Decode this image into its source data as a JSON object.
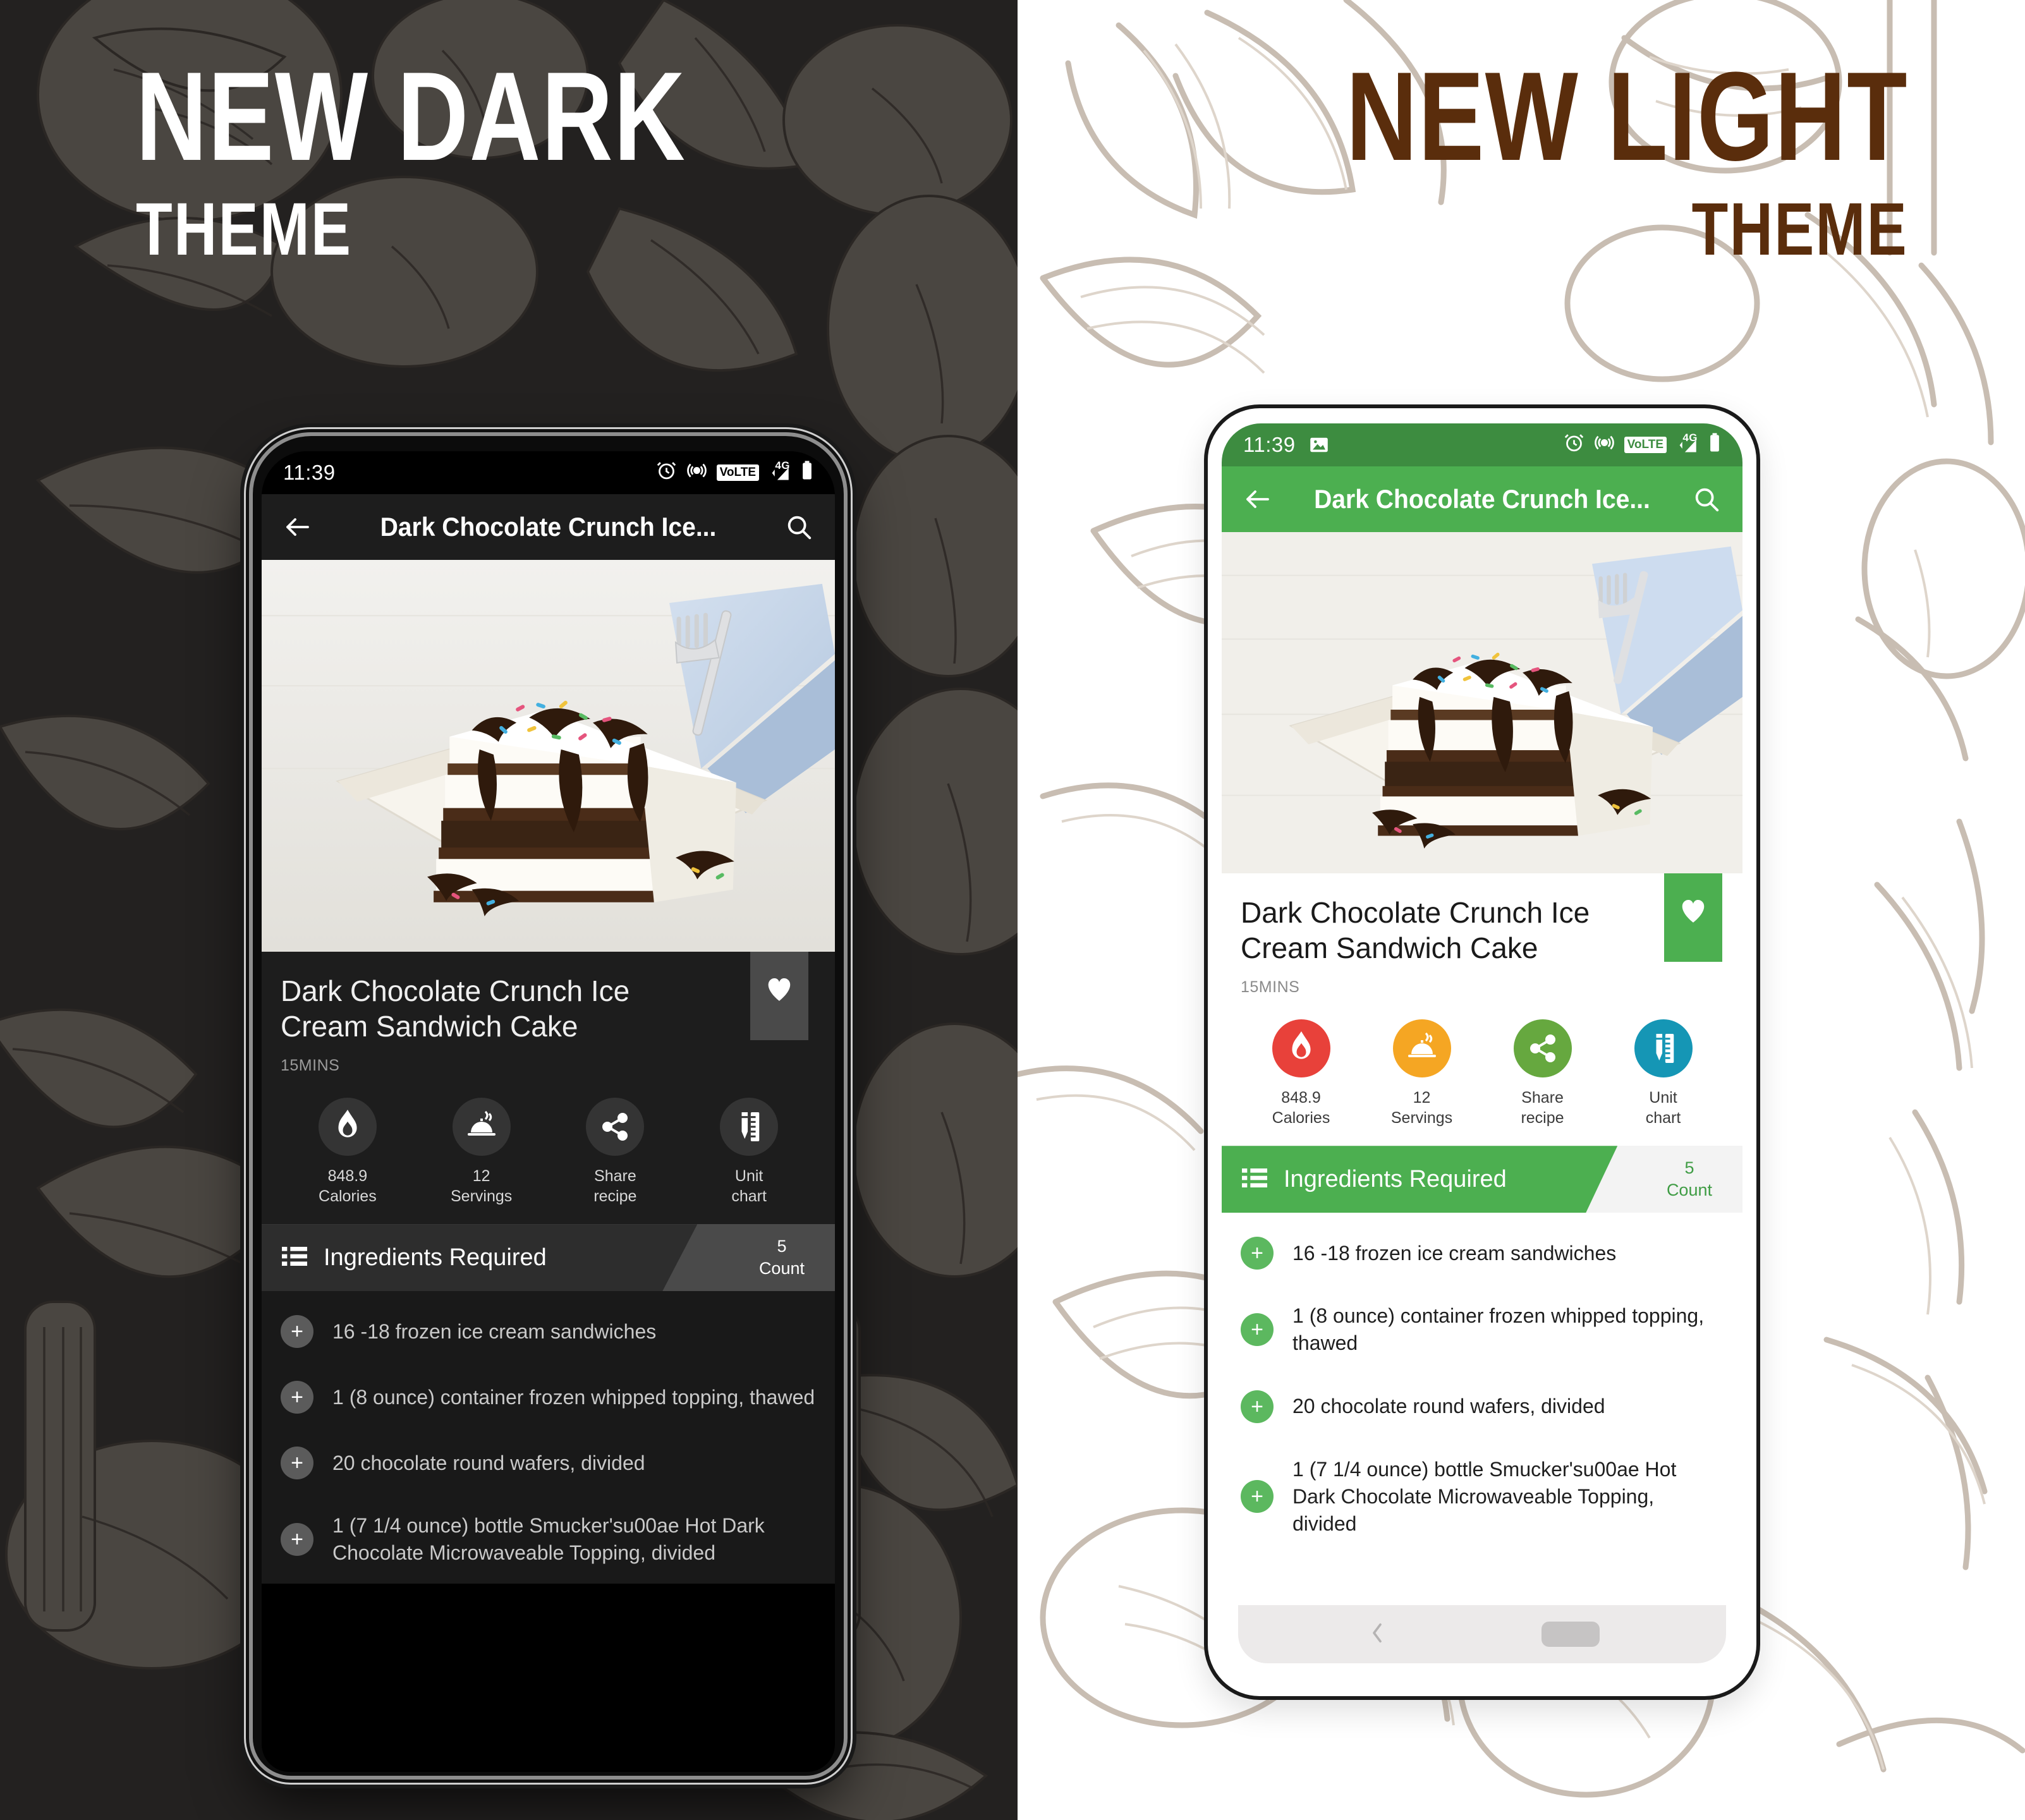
{
  "dark_panel": {
    "heading_main": "NEW DARK",
    "heading_sub": "THEME",
    "heading_color": "#ffffff",
    "background_color": "#232120"
  },
  "light_panel": {
    "heading_main": "NEW LIGHT",
    "heading_sub": "THEME",
    "heading_color": "#5a2d0c",
    "background_color": "#ffffff"
  },
  "dark_phone": {
    "status_bar": {
      "time": "11:39",
      "volte_label": "VoLTE",
      "network_label": "4G",
      "icons": [
        "alarm-icon",
        "location-icon",
        "volte-icon",
        "signal-icon",
        "battery-icon"
      ]
    },
    "app_bar": {
      "back_icon": "back-arrow-icon",
      "title": "Dark Chocolate Crunch Ice...",
      "search_icon": "search-icon",
      "background_color": "#1d1d1d"
    },
    "recipe": {
      "title": "Dark Chocolate Crunch Ice Cream Sandwich Cake",
      "time": "15MINS",
      "bookmark_icon": "heart-icon"
    },
    "actions": [
      {
        "icon": "flame-icon",
        "value": "848.9",
        "label": "Calories"
      },
      {
        "icon": "cloche-icon",
        "value": "12",
        "label": "Servings"
      },
      {
        "icon": "share-icon",
        "value": "Share",
        "label": "recipe"
      },
      {
        "icon": "ruler-icon",
        "value": "Unit",
        "label": "chart"
      }
    ],
    "ingredients_header": {
      "icon": "list-icon",
      "title": "Ingredients Required",
      "count_value": "5",
      "count_label": "Count"
    },
    "ingredients": [
      "16 -18 frozen ice cream sandwiches",
      "1 (8 ounce) container frozen whipped topping, thawed",
      "20 chocolate round wafers, divided",
      "1 (7 1/4 ounce) bottle Smucker'su00ae Hot Dark Chocolate Microwaveable Topping, divided"
    ]
  },
  "light_phone": {
    "status_bar": {
      "time": "11:39",
      "volte_label": "VoLTE",
      "network_label": "4G",
      "icons": [
        "gallery-icon",
        "alarm-icon",
        "location-icon",
        "volte-icon",
        "signal-icon",
        "battery-icon"
      ],
      "background_color": "#3d8c40"
    },
    "app_bar": {
      "back_icon": "back-arrow-icon",
      "title": "Dark Chocolate Crunch Ice...",
      "search_icon": "search-icon",
      "background_color": "#4caf50"
    },
    "recipe": {
      "title": "Dark Chocolate Crunch Ice Cream Sandwich Cake",
      "time": "15MINS",
      "bookmark_icon": "heart-icon"
    },
    "actions": [
      {
        "icon": "flame-icon",
        "value": "848.9",
        "label": "Calories",
        "color": "#e8413a"
      },
      {
        "icon": "cloche-icon",
        "value": "12",
        "label": "Servings",
        "color": "#f5a623"
      },
      {
        "icon": "share-icon",
        "value": "Share",
        "label": "recipe",
        "color": "#66a83f"
      },
      {
        "icon": "ruler-icon",
        "value": "Unit",
        "label": "chart",
        "color": "#1596b5"
      }
    ],
    "ingredients_header": {
      "icon": "list-icon",
      "title": "Ingredients Required",
      "count_value": "5",
      "count_label": "Count"
    },
    "ingredients": [
      "16 -18 frozen ice cream sandwiches",
      "1 (8 ounce) container frozen whipped topping, thawed",
      "20 chocolate round wafers, divided",
      "1 (7 1/4 ounce) bottle Smucker'su00ae Hot Dark Chocolate Microwaveable Topping, divided"
    ],
    "nav_bar": {
      "back_icon": "nav-back-icon",
      "home_icon": "nav-home-pill"
    }
  }
}
